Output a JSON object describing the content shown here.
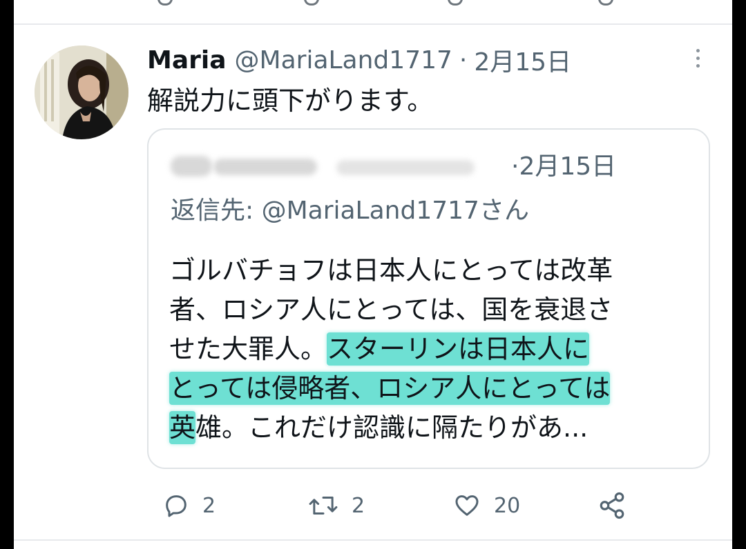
{
  "tweet": {
    "author_name": "Maria",
    "handle": "@MariaLand1717",
    "separator": "·",
    "date": "2月15日",
    "text": "解説力に頭下がります。"
  },
  "quoted_tweet": {
    "date": "2月15日",
    "reply_to": "返信先: @MariaLand1717さん",
    "lines": [
      {
        "plain": "ゴルバチョフは日本人にとっては改革",
        "highlight": ""
      },
      {
        "plain": "者、ロシア人にとっては、国を衰退さ",
        "highlight": ""
      },
      {
        "plain": "せた大罪人。",
        "highlight": "スターリンは日本人に"
      },
      {
        "plain": "",
        "highlight": "とっては侵略者、ロシア人にとっては"
      },
      {
        "plain": "雄。これだけ認識に隔たりがあ...",
        "highlight": "英"
      }
    ]
  },
  "actions": {
    "replies": "2",
    "retweets": "2",
    "likes": "20"
  },
  "colors": {
    "highlight": "#6ee0d3",
    "secondary_text": "#536471",
    "primary_text": "#0f1419"
  },
  "icons": [
    "more-icon",
    "reply-icon",
    "retweet-icon",
    "like-icon",
    "share-icon"
  ]
}
